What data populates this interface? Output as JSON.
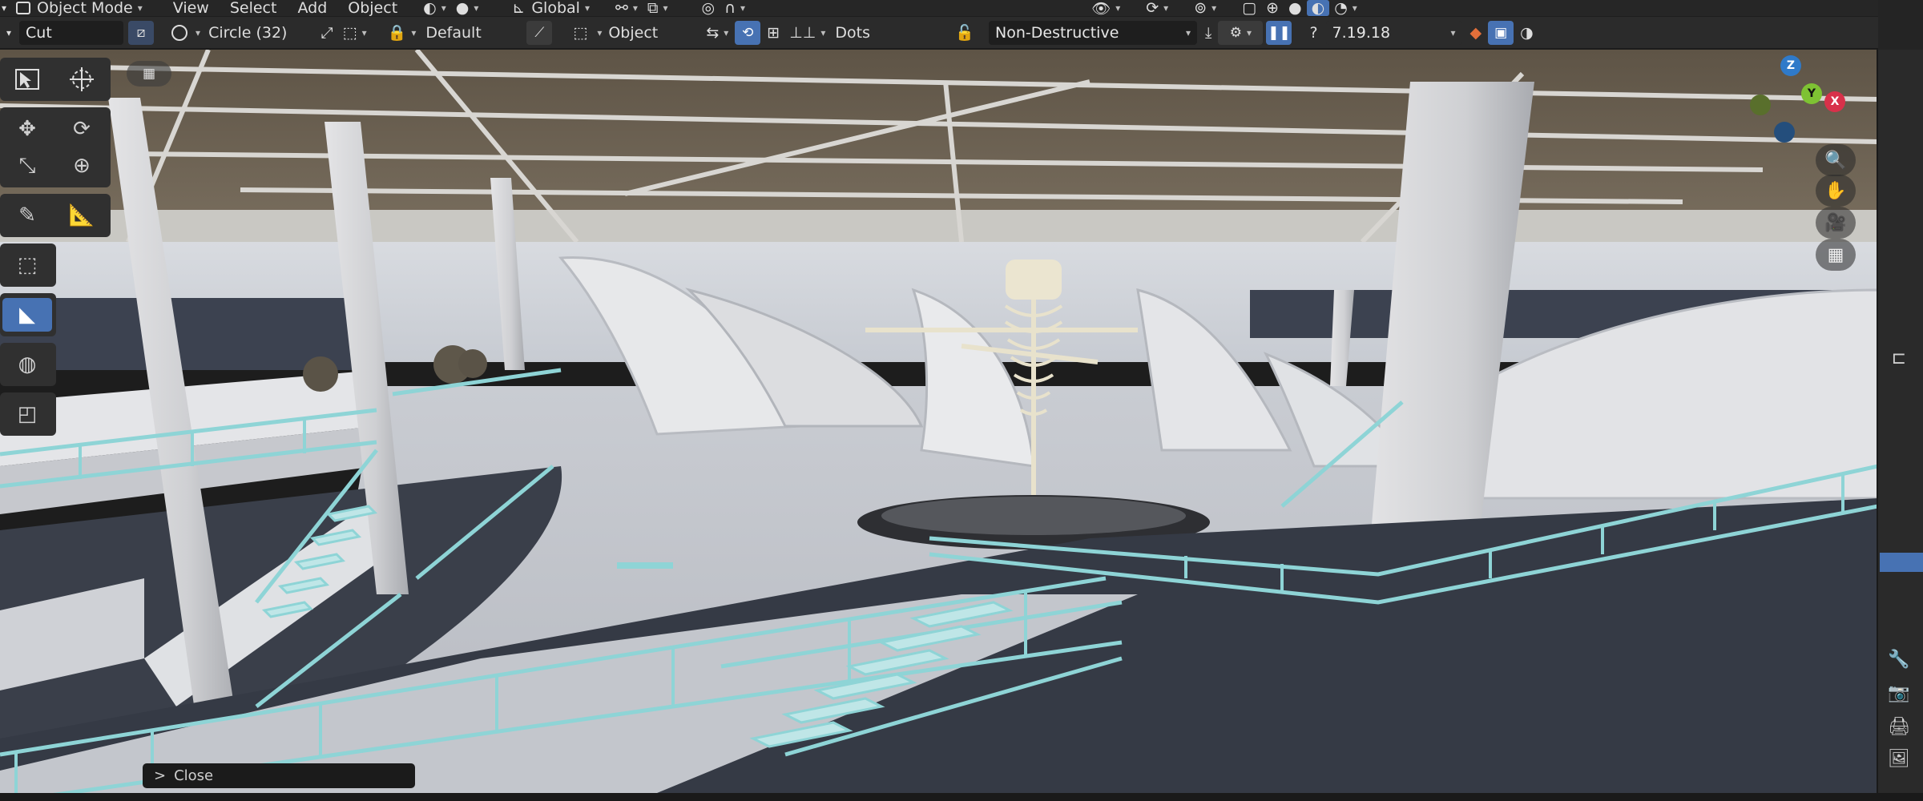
{
  "header1": {
    "mode": "Object Mode",
    "menus": [
      "View",
      "Select",
      "Add",
      "Object"
    ],
    "orientation": "Global"
  },
  "header2": {
    "tool": "Cut",
    "brush_shape": "Circle (32)",
    "orientation_preset": "Default",
    "target": "Object",
    "display": "Dots",
    "mode": "Non-Destructive",
    "version": "7.19.18"
  },
  "toolbar": {
    "icons": [
      "select-box-icon",
      "cursor-icon",
      "move-icon",
      "rotate-icon",
      "scale-icon",
      "transform-icon",
      "annotate-icon",
      "measure-icon",
      "add-cube-icon",
      "cut-icon",
      "shape-icon",
      "extrude-icon"
    ]
  },
  "gizmo": {
    "z": "Z",
    "y": "Y",
    "x": "X"
  },
  "nav": {
    "icons": [
      "zoom-icon",
      "pan-icon",
      "camera-icon",
      "grid-icon"
    ]
  },
  "operator_panel": {
    "label": "Close"
  },
  "colors": {
    "accent": "#4772b3",
    "railing": "#8ed4d6",
    "floor": "#3a3f4a"
  }
}
